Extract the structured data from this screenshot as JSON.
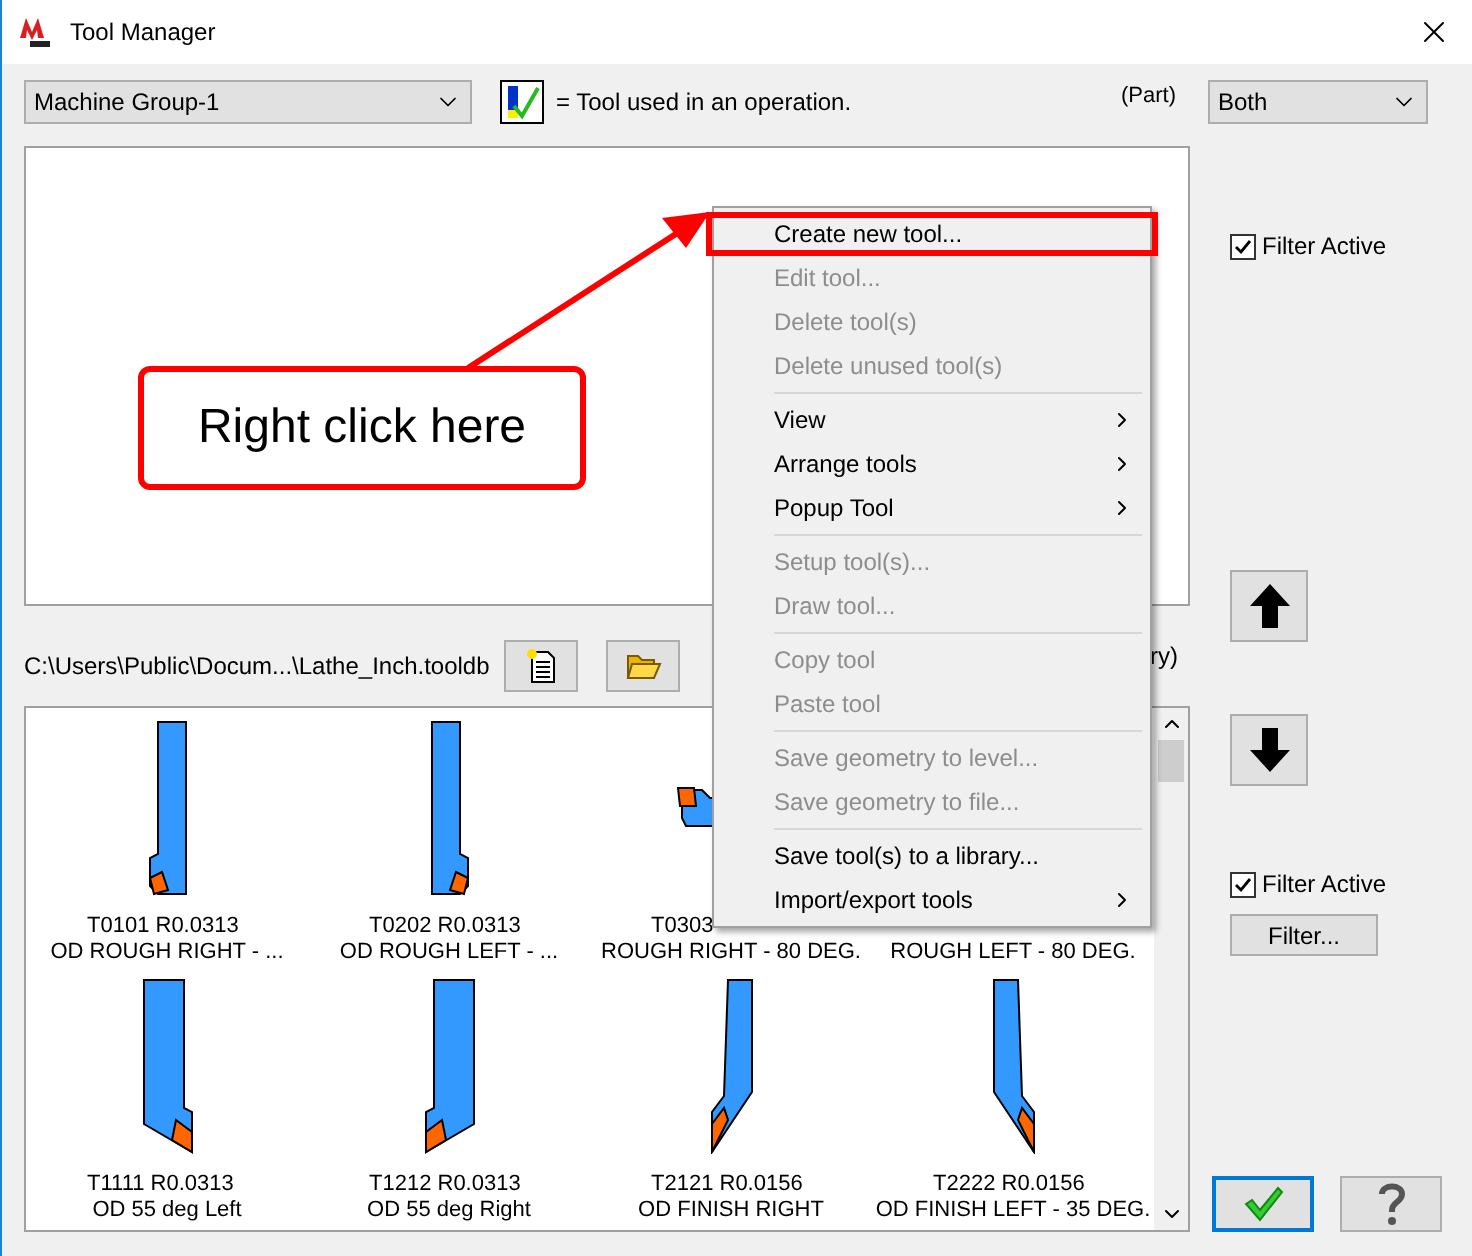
{
  "window": {
    "title": "Tool Manager"
  },
  "machine_group": {
    "value": "Machine Group-1"
  },
  "legend": {
    "text": "= Tool used in an operation."
  },
  "part_label": "(Part)",
  "part_filter": {
    "value": "Both"
  },
  "upper_filter": {
    "label": "Filter Active",
    "checked": true
  },
  "library": {
    "path": "C:\\Users\\Public\\Docum...\\Lathe_Inch.tooldb",
    "label_fragment": "ry)"
  },
  "tools": [
    {
      "kind": "rough-right",
      "id": "T0101 R0.0313",
      "description": "OD ROUGH RIGHT - ..."
    },
    {
      "kind": "rough-left",
      "id": "T0202 R0.0313",
      "description": "OD ROUGH LEFT - ..."
    },
    {
      "kind": "side",
      "id": "T0303",
      "description": "ROUGH RIGHT - 80 DEG."
    },
    {
      "description": "ROUGH LEFT - 80 DEG."
    },
    {
      "kind": "angled-right",
      "id": "T1111 R0.0313",
      "description": "OD 55 deg Left"
    },
    {
      "kind": "angled-left",
      "id": "T1212 R0.0313",
      "description": "OD 55 deg Right"
    },
    {
      "kind": "finish-right",
      "id": "T2121 R0.0156",
      "description": "OD FINISH RIGHT"
    },
    {
      "kind": "finish-left",
      "id": "T2222 R0.0156",
      "description": "OD FINISH LEFT - 35 DEG."
    }
  ],
  "lower_filter": {
    "label": "Filter Active",
    "checked": true
  },
  "filter_button": "Filter...",
  "context_menu": {
    "groups": [
      {
        "items": [
          {
            "label": "Create new tool...",
            "disabled": false,
            "submenu": false,
            "selected": true
          },
          {
            "label": "Edit tool...",
            "disabled": true,
            "submenu": false,
            "selected": false
          },
          {
            "label": "Delete tool(s)",
            "disabled": true,
            "submenu": false,
            "selected": false
          },
          {
            "label": "Delete unused tool(s)",
            "disabled": true,
            "submenu": false,
            "selected": false
          }
        ]
      },
      {
        "items": [
          {
            "label": "View",
            "disabled": false,
            "submenu": true,
            "selected": false
          },
          {
            "label": "Arrange tools",
            "disabled": false,
            "submenu": true,
            "selected": false
          },
          {
            "label": "Popup Tool",
            "disabled": false,
            "submenu": true,
            "selected": false
          }
        ]
      },
      {
        "items": [
          {
            "label": "Setup tool(s)...",
            "disabled": true,
            "submenu": false,
            "selected": false
          },
          {
            "label": "Draw tool...",
            "disabled": true,
            "submenu": false,
            "selected": false
          }
        ]
      },
      {
        "items": [
          {
            "label": "Copy tool",
            "disabled": true,
            "submenu": false,
            "selected": false
          },
          {
            "label": "Paste tool",
            "disabled": true,
            "submenu": false,
            "selected": false
          }
        ]
      },
      {
        "items": [
          {
            "label": "Save geometry to level...",
            "disabled": true,
            "submenu": false,
            "selected": false
          },
          {
            "label": "Save geometry to file...",
            "disabled": true,
            "submenu": false,
            "selected": false
          }
        ]
      },
      {
        "items": [
          {
            "label": "Save tool(s) to a library...",
            "disabled": false,
            "submenu": false,
            "selected": false
          },
          {
            "label": "Import/export tools",
            "disabled": false,
            "submenu": true,
            "selected": false
          }
        ]
      }
    ]
  },
  "callout": {
    "text": "Right click here"
  }
}
